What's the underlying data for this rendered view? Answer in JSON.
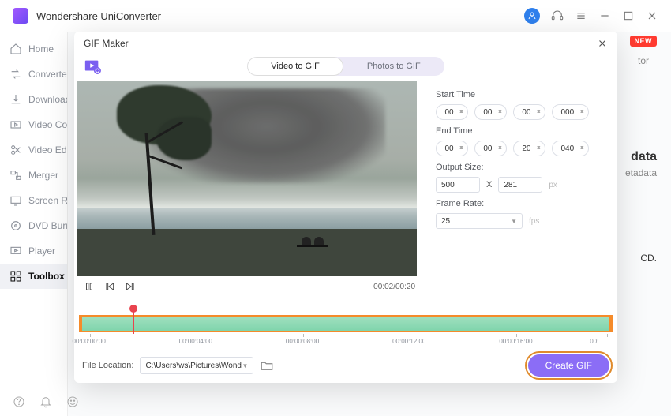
{
  "app": {
    "title": "Wondershare UniConverter"
  },
  "titlebar": {
    "badge_new": "NEW"
  },
  "sidebar": {
    "items": [
      {
        "label": "Home"
      },
      {
        "label": "Converter"
      },
      {
        "label": "Downloader"
      },
      {
        "label": "Video Compressor"
      },
      {
        "label": "Video Editor"
      },
      {
        "label": "Merger"
      },
      {
        "label": "Screen Recorder"
      },
      {
        "label": "DVD Burner"
      },
      {
        "label": "Player"
      },
      {
        "label": "Toolbox"
      }
    ]
  },
  "bg": {
    "tor": "tor",
    "data": "data",
    "etadata": "etadata",
    "cd": "CD."
  },
  "modal": {
    "title": "GIF Maker",
    "tabs": {
      "video": "Video to GIF",
      "photos": "Photos to GIF"
    },
    "start_label": "Start Time",
    "end_label": "End Time",
    "start": {
      "h": "00",
      "m": "00",
      "s": "00",
      "ms": "000"
    },
    "end": {
      "h": "00",
      "m": "00",
      "s": "20",
      "ms": "040"
    },
    "output_label": "Output Size:",
    "output": {
      "w": "500",
      "x": "X",
      "h": "281",
      "unit": "px"
    },
    "rate_label": "Frame Rate:",
    "rate": {
      "value": "25",
      "unit": "fps"
    },
    "player": {
      "time": "00:02/00:20"
    },
    "ruler": [
      "00:00:00:00",
      "00:00:04:00",
      "00:00:08:00",
      "00:00:12:00",
      "00:00:16:00",
      "00:"
    ],
    "file_loc_label": "File Location:",
    "file_loc": "C:\\Users\\ws\\Pictures\\Wonders",
    "create_label": "Create GIF"
  }
}
